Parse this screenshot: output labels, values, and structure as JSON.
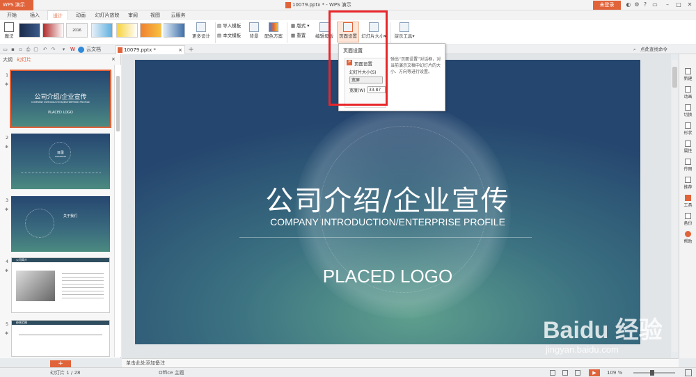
{
  "app": {
    "name": "WPS 演示",
    "doc_title": "10079.pptx * - WPS 演示",
    "login": "未登录"
  },
  "menu": [
    "开始",
    "插入",
    "设计",
    "动画",
    "幻灯片放映",
    "审阅",
    "视图",
    "云服务"
  ],
  "active_menu": "设计",
  "ribbon": {
    "magic": "魔法",
    "more_design": "更多设计",
    "import_template": "导入模板",
    "body_template": "本文模板",
    "background": "背景",
    "color_scheme": "配色方案",
    "layout": "版式",
    "reset": "重置",
    "edit_master": "编辑母版",
    "page_setup": "页面设置",
    "slide_size": "幻灯片大小",
    "presentation_tools": "演示工具",
    "theme_thumb_label": "2016"
  },
  "quickbar": {
    "cloud_docs": "云文档",
    "file_tab": "10079.pptx *",
    "command_search": "点此查找命令"
  },
  "left_panel": {
    "tab_outline": "大纲",
    "tab_slides": "幻灯片",
    "slides": [
      {
        "num": "1",
        "title": "公司介绍/企业宣传",
        "sub": "COMPANY INTRODUCTION/ENTERPRISE PROFILE",
        "logo": "PLACED LOGO"
      },
      {
        "num": "2",
        "title": "目录",
        "sub": "CONTENTS"
      },
      {
        "num": "3",
        "title": "关于我们"
      },
      {
        "num": "4",
        "title": "公司简介"
      },
      {
        "num": "5",
        "title": "经营范围"
      }
    ]
  },
  "slide": {
    "title": "公司介绍/企业宣传",
    "subtitle": "COMPANY INTRODUCTION/ENTERPRISE PROFILE",
    "logo": "PLACED LOGO"
  },
  "popup": {
    "title": "页面设置",
    "inner_title": "页面设置",
    "slide_size_label": "幻灯片大小(S)",
    "widescreen": "宽屏",
    "width_label": "宽度(W)",
    "width_value": "33.87",
    "description": "弹出“页面设置”对话框，对当前演示文稿中幻灯片的大小、方向等进行设置。"
  },
  "right_sidebar": [
    "新建",
    "动画",
    "切换",
    "形状",
    "属性",
    "传图",
    "推荐",
    "工具",
    "备份",
    "帮助"
  ],
  "notes_placeholder": "单击此处添加备注",
  "status": {
    "slide_counter": "幻灯片 1 / 28",
    "theme": "Office 主题",
    "zoom": "109 %"
  },
  "watermark": {
    "brand": "Baidu 经验",
    "url": "jingyan.baidu.com"
  },
  "colors": {
    "accent": "#e1633a",
    "highlight_box": "#e8262b"
  }
}
